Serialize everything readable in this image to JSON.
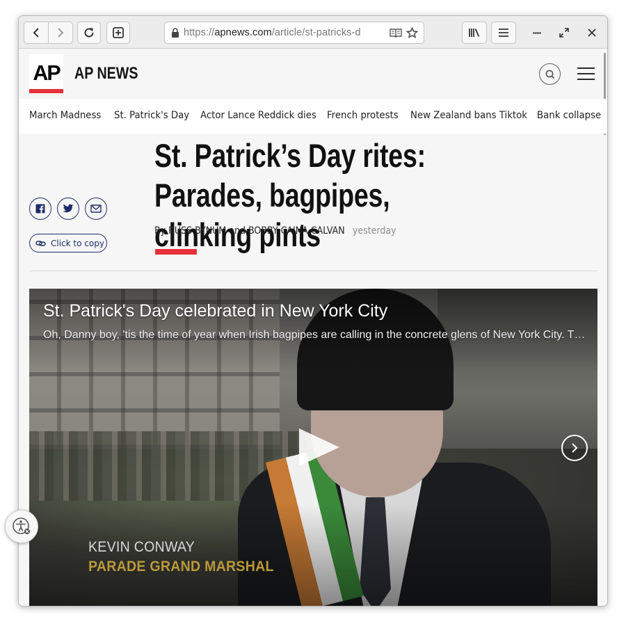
{
  "browser": {
    "url_prefix": "https://",
    "url_domain": "apnews.com",
    "url_path": "/article/st-patricks-d"
  },
  "site": {
    "logo_text": "AP",
    "name": "AP NEWS"
  },
  "trending": [
    "March Madness",
    "St. Patrick's Day",
    "Actor Lance Reddick dies",
    "French protests",
    "New Zealand bans Tiktok",
    "Bank collapse"
  ],
  "share": {
    "copy_label": "Click to copy"
  },
  "article": {
    "headline": "St. Patrick’s Day rites: Parades, bagpipes, clinking pints",
    "by": "By",
    "author1": "RUSS BYNUM",
    "and": "and",
    "author2": "BOBBY CAINA CALVAN",
    "time": "yesterday"
  },
  "video": {
    "title": "St. Patrick's Day celebrated in New York City",
    "description": "Oh, Danny boy, 'tis the time of year when Irish bagpipes are calling in the concrete glens of New York City. T…",
    "lower_third_name": "KEVIN CONWAY",
    "lower_third_role": "PARADE GRAND MARSHAL"
  },
  "colors": {
    "accent_red": "#e8313a",
    "share_navy": "#1d2d6b",
    "role_gold": "#b99a3a"
  }
}
